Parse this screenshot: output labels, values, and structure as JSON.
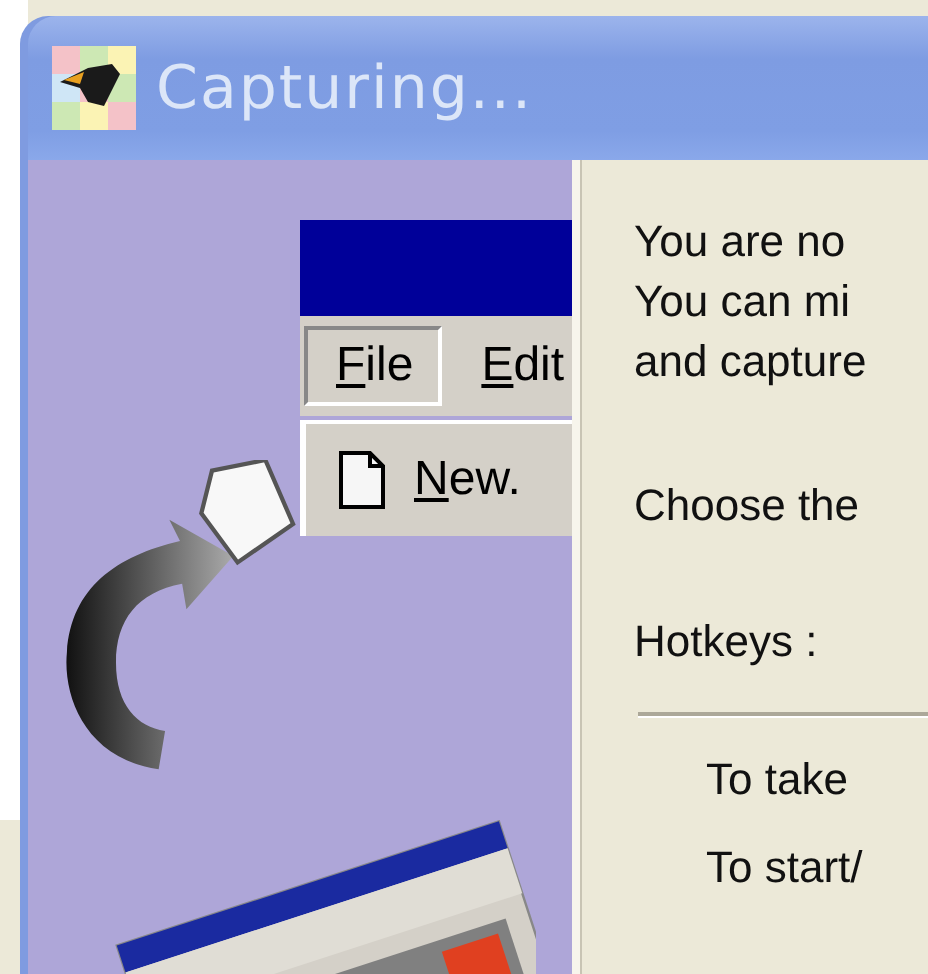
{
  "window": {
    "title": "Capturing..."
  },
  "illustration": {
    "menu_items": [
      {
        "label": "File",
        "selected": true
      },
      {
        "label": "Edit",
        "selected": false
      }
    ],
    "dropdown_item": "New."
  },
  "message_lines": [
    "You are no",
    "You can mi",
    "and capture"
  ],
  "choose_text": "Choose the",
  "hotkeys_label": "Hotkeys :",
  "hotkey_lines": [
    "To take",
    "To start/"
  ]
}
